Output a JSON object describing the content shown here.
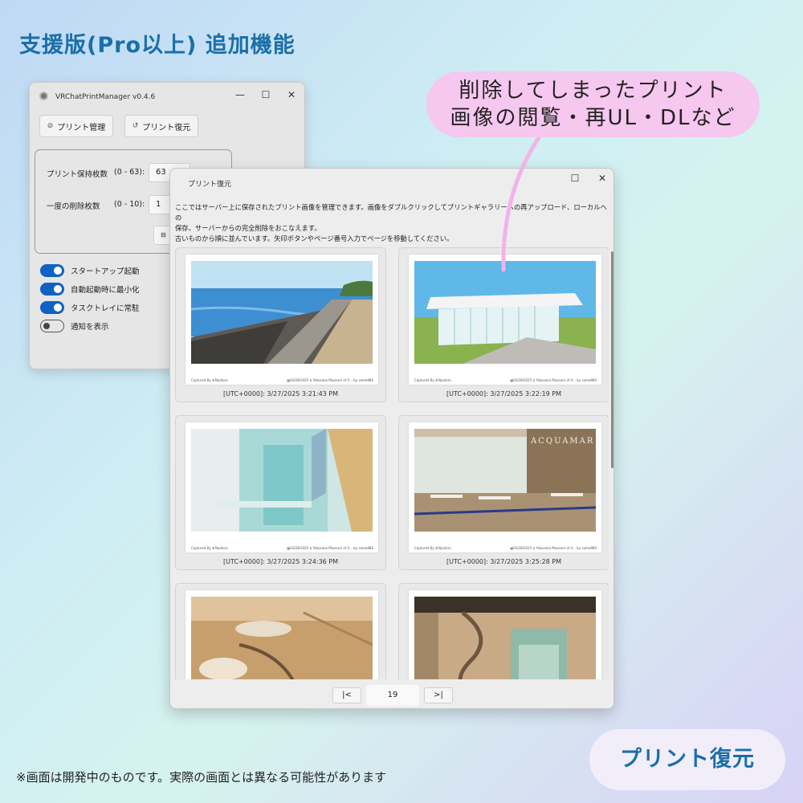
{
  "heading": "支援版(Pro以上) 追加機能",
  "main_window": {
    "title": "VRChatPrintManager v0.4.6",
    "controls": {
      "minimize": "—",
      "maximize": "☐",
      "close": "✕"
    },
    "buttons": {
      "print_manage": "プリント管理",
      "print_restore": "プリント復元"
    },
    "settings": {
      "hold_label": "プリント保持枚数",
      "hold_range": "(0 - 63):",
      "hold_value": "63",
      "delete_label": "一度の削除枚数",
      "delete_range": "(0 - 10):",
      "delete_value": "1"
    },
    "toggles": [
      {
        "label": "スタートアップ起動",
        "on": true
      },
      {
        "label": "自動起動時に最小化",
        "on": true
      },
      {
        "label": "タスクトレイに常駐",
        "on": true
      },
      {
        "label": "通知を表示",
        "on": false
      }
    ]
  },
  "restore_window": {
    "title": "プリント復元",
    "controls": {
      "maximize": "☐",
      "close": "✕"
    },
    "description": [
      "ここではサーバー上に保存されたプリント画像を管理できます。画像をダブルクリックしてプリントギャラリーへの再アップロード、ローカルへの",
      "保存、サーバーからの完全削除をおこなえます。",
      "古いものから順に並んでいます。矢印ボタンやページ番号入力でページを移動してください。"
    ],
    "prints": [
      {
        "caption": "[UTC+0000]: 3/27/2025 3:21:43 PM",
        "foot_left": "Captured By ∄ Nyatoro",
        "foot_right": "▦03/28/2025 ♀ Yokosuka Museum of A... by some88S"
      },
      {
        "caption": "[UTC+0000]: 3/27/2025 3:22:19 PM",
        "foot_left": "Captured By ∄ Nyatoro",
        "foot_right": "▦03/28/2025 ♀ Yokosuka Museum of A... by some88S"
      },
      {
        "caption": "[UTC+0000]: 3/27/2025 3:24:36 PM",
        "foot_left": "Captured By ∄ Nyatoro",
        "foot_right": "▦03/28/2025 ♀ Yokosuka Museum of A... by some88S"
      },
      {
        "caption": "[UTC+0000]: 3/27/2025 3:25:28 PM",
        "foot_left": "Captured By ∄ Nyatoro",
        "foot_right": "▦03/28/2025 ♀ Yokosuka Museum of A... by some88S",
        "sign": "ACQUAMAR"
      },
      {
        "caption": "",
        "foot_left": "",
        "foot_right": ""
      },
      {
        "caption": "",
        "foot_left": "",
        "foot_right": ""
      }
    ],
    "pager": {
      "prev_icon": "|<",
      "page": "19",
      "next_icon": ">|"
    }
  },
  "callout": {
    "line1": "削除してしまったプリント",
    "line2": "画像の閲覧・再UL・DLなど"
  },
  "badge": "プリント復元",
  "footnote": "※画面は開発中のものです。実際の画面とは異なる可能性があります"
}
